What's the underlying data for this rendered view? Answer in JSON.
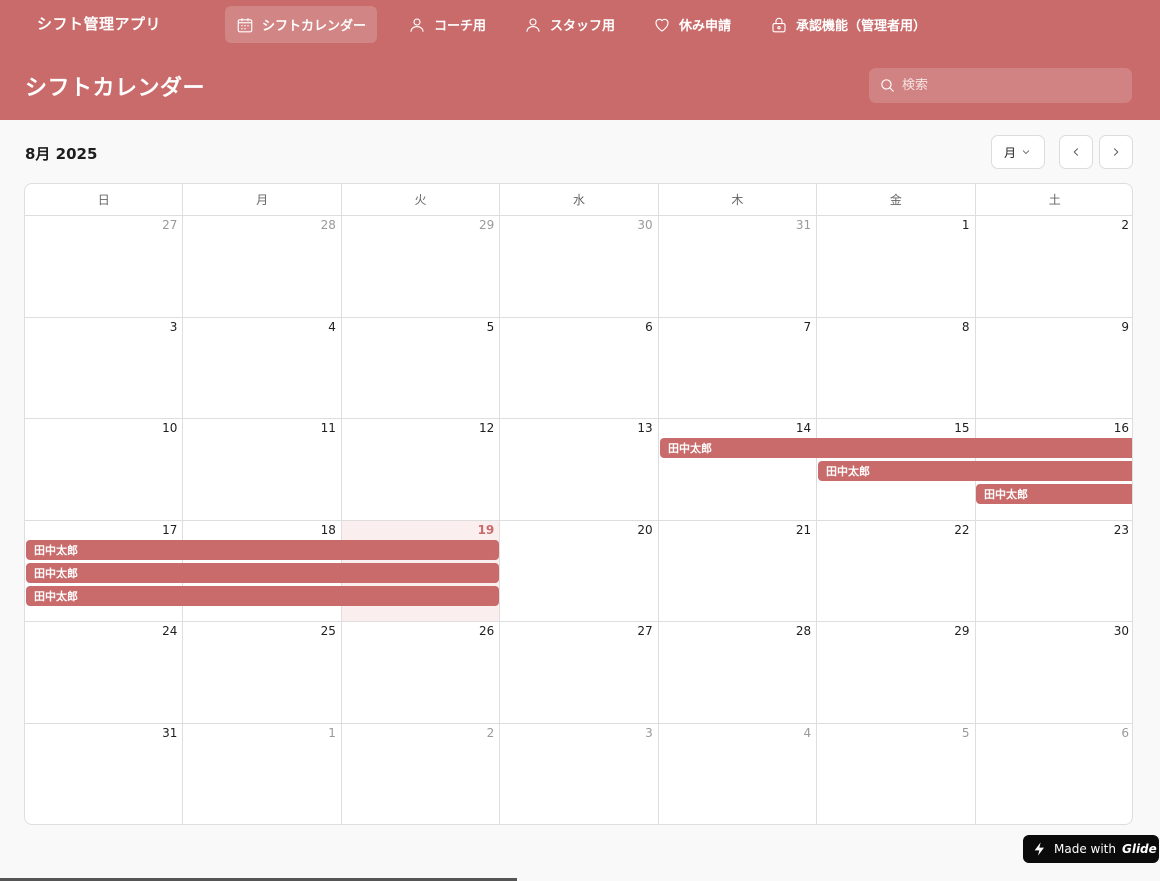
{
  "app": {
    "title": "シフト管理アプリ"
  },
  "nav": {
    "items": [
      {
        "label": "シフトカレンダー",
        "icon": "calendar-icon",
        "active": true
      },
      {
        "label": "コーチ用",
        "icon": "person-icon"
      },
      {
        "label": "スタッフ用",
        "icon": "person-icon"
      },
      {
        "label": "休み申請",
        "icon": "heart-icon"
      },
      {
        "label": "承認機能（管理者用）",
        "icon": "lock-icon"
      }
    ]
  },
  "header": {
    "title": "シフトカレンダー",
    "search_placeholder": "検索"
  },
  "calendar": {
    "month_label": "8月 2025",
    "view_label": "月",
    "weekdays": [
      "日",
      "月",
      "火",
      "水",
      "木",
      "金",
      "土"
    ],
    "days": [
      "27",
      "28",
      "29",
      "30",
      "31",
      "1",
      "2",
      "3",
      "4",
      "5",
      "6",
      "7",
      "8",
      "9",
      "10",
      "11",
      "12",
      "13",
      "14",
      "15",
      "16",
      "17",
      "18",
      "19",
      "20",
      "21",
      "22",
      "23",
      "24",
      "25",
      "26",
      "27",
      "28",
      "29",
      "30",
      "31",
      "1",
      "2",
      "3",
      "4",
      "5",
      "6"
    ],
    "today": "19",
    "events": [
      {
        "label": "田中太郎"
      },
      {
        "label": "田中太郎"
      },
      {
        "label": "田中太郎"
      },
      {
        "label": "田中太郎"
      },
      {
        "label": "田中太郎"
      },
      {
        "label": "田中太郎"
      }
    ]
  },
  "colors": {
    "accent": "#c96b6b",
    "today_bg": "#fbeeee"
  },
  "footer": {
    "made_with": "Made with",
    "brand": "Glide"
  }
}
